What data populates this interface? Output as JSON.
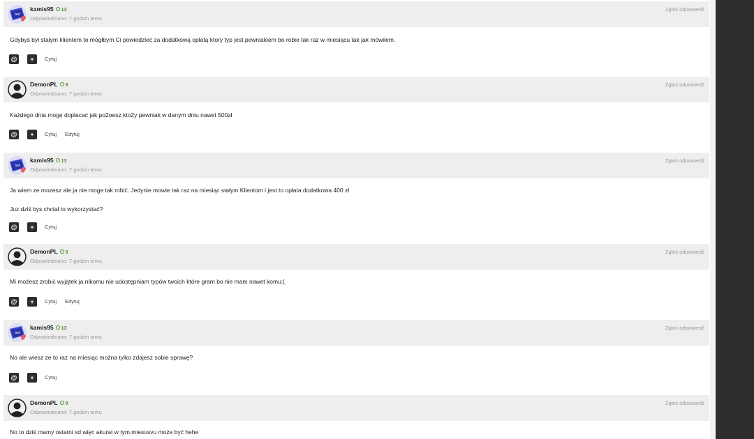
{
  "posts": [
    {
      "author": "kamis95",
      "reputation": "13",
      "meta": "Odpowiedziano: 7 godzin temu",
      "report": "Zgłoś odpowiedź",
      "avatar": "kamis95-avatar",
      "lines": [
        "Gdybyś był stałym klientem to mógłbym Ci powiedzieć za dodatkową opłatą ktory typ jest pewniakiem bo robie tak raz w miesiącu tak jak mówiłem."
      ],
      "quote": "Cytuj",
      "edit": ""
    },
    {
      "author": "DemonPL",
      "reputation": "9",
      "meta": "Odpowiedziano: 7 godzin temu",
      "report": "Zgłoś odpowiedź",
      "avatar": "default-avatar",
      "lines": [
        "Każdego dnia mogę dopłacać jak po2oesz kto2y pewniak w danym dniu nawet 500zł"
      ],
      "quote": "Cytuj",
      "edit": "Edytuj"
    },
    {
      "author": "kamis95",
      "reputation": "13",
      "meta": "Odpowiedziano: 7 godzin temu",
      "report": "Zgłoś odpowiedź",
      "avatar": "kamis95-avatar",
      "lines": [
        "Ja wiem ze mozesz ale ja nie moge tak robić. Jedynie mowie tak raz na miesiąc stałym Klientom i jest to opłata dodatkowa 400 zł",
        "Juz dziś bys chciał to wykorzystać?"
      ],
      "quote": "Cytuj",
      "edit": ""
    },
    {
      "author": "DemonPL",
      "reputation": "9",
      "meta": "Odpowiedziano: 7 godzin temu",
      "report": "Zgłoś odpowiedź",
      "avatar": "default-avatar",
      "lines": [
        "Mi możesz zrobić wyjątek ja nikomu nie udostępniam typów twoich które gram bo nie mam nawet komu:("
      ],
      "quote": "Cytuj",
      "edit": "Edytuj"
    },
    {
      "author": "kamis95",
      "reputation": "13",
      "meta": "Odpowiedziano: 7 godzin temu",
      "report": "Zgłoś odpowiedź",
      "avatar": "kamis95-avatar",
      "lines": [
        "No ale wiesz ze to raz na miesiąc można tylko zdajesz sobie sprawę?"
      ],
      "quote": "Cytuj",
      "edit": ""
    },
    {
      "author": "DemonPL",
      "reputation": "9",
      "meta": "Odpowiedziano: 7 godzin temu",
      "report": "Zgłoś odpowiedź",
      "avatar": "default-avatar",
      "lines": [
        "No to dziś mamy ostatni xd więc akurat w tym.miesusvu może być hehe"
      ],
      "quote": "",
      "edit": ""
    }
  ],
  "icons": {
    "mention": "@",
    "plus": "+"
  },
  "colors": {
    "header_bg": "#eeeeee",
    "button_bg": "#2d2d2d",
    "reputation": "#4f8f2f",
    "dark_panel": "#2d2d2d"
  }
}
